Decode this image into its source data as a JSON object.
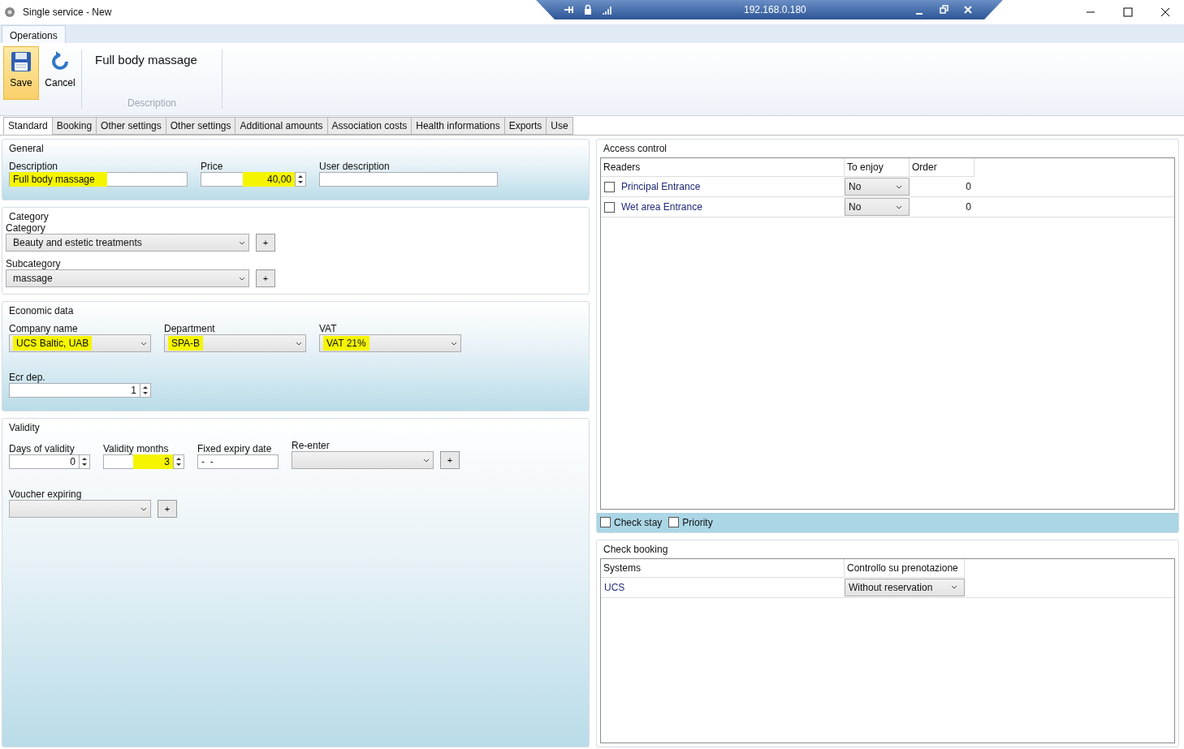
{
  "window": {
    "title": "Single service - New"
  },
  "remote_bar": {
    "address": "192.168.0.180"
  },
  "ribbon": {
    "tabs": [
      {
        "label": "Operations",
        "selected": true
      }
    ],
    "buttons": [
      {
        "label": "Save",
        "kind": "save",
        "selected": true
      },
      {
        "label": "Cancel",
        "kind": "cancel",
        "selected": false
      }
    ],
    "description": "Full body massage",
    "group_label": "Description"
  },
  "tabs": [
    {
      "label": "Standard",
      "selected": true
    },
    {
      "label": "Booking",
      "selected": false
    },
    {
      "label": "Other settings",
      "selected": false
    },
    {
      "label": "Other settings",
      "selected": false
    },
    {
      "label": "Additional amounts",
      "selected": false
    },
    {
      "label": "Association costs",
      "selected": false
    },
    {
      "label": "Health informations",
      "selected": false
    },
    {
      "label": "Exports",
      "selected": false
    },
    {
      "label": "Use",
      "selected": false
    }
  ],
  "sections": [
    {
      "title": "General",
      "kind": "shaded",
      "rows": [
        [
          {
            "label": "Description",
            "kind": "text",
            "value": "Full body massage",
            "highlighted": true
          },
          {
            "label": "Price",
            "kind": "spin",
            "value": "40,00",
            "highlighted": true
          },
          {
            "label": "User description",
            "kind": "text"
          }
        ]
      ]
    },
    {
      "title": "Category",
      "kind": "plain",
      "rows": [
        [
          {
            "label": "Category",
            "kind": "combo",
            "value": "Beauty and estetic treatments",
            "add": "+"
          }
        ],
        [
          {
            "label": "Subcategory",
            "kind": "combo",
            "value": "massage",
            "add": "+"
          }
        ]
      ]
    },
    {
      "title": "Economic data",
      "kind": "shaded",
      "rows": [
        [
          {
            "label": "Company name",
            "kind": "combo",
            "value": "UCS Baltic, UAB",
            "highlighted": true
          },
          {
            "label": "Department",
            "kind": "combo",
            "value": "SPA-B",
            "highlighted": true
          },
          {
            "label": "VAT",
            "kind": "combo",
            "value": "VAT 21%",
            "highlighted": true
          }
        ],
        [
          {
            "label": "Ecr dep.",
            "kind": "spin",
            "value": "1"
          }
        ]
      ]
    },
    {
      "title": "Validity",
      "kind": "shaded",
      "rows": [
        [
          {
            "label": "Days of validity",
            "kind": "spin",
            "value": "0"
          },
          {
            "label": "Validity months",
            "kind": "spin",
            "value": "3",
            "highlighted": true
          },
          {
            "label": "Fixed expiry date",
            "kind": "text",
            "value": "-  -"
          },
          {
            "label": "Re-enter",
            "kind": "combo",
            "add": "+"
          }
        ],
        [
          {
            "label": "Voucher expiring",
            "kind": "combo",
            "add": "+"
          }
        ]
      ]
    }
  ],
  "access_control": {
    "title": "Access control",
    "columns": [
      "Readers",
      "To enjoy",
      "Order"
    ],
    "rows": [
      {
        "reader": "Principal Entrance",
        "checked": false,
        "to_enjoy": "No",
        "order": "0"
      },
      {
        "reader": "Wet area Entrance",
        "checked": false,
        "to_enjoy": "No",
        "order": "0"
      }
    ],
    "options": [
      {
        "label": "Check stay",
        "checked": false
      },
      {
        "label": "Priority",
        "checked": false
      }
    ]
  },
  "check_booking": {
    "title": "Check booking",
    "columns": [
      "Systems",
      "Controllo su prenotazione"
    ],
    "rows": [
      {
        "system": "UCS",
        "control": "Without reservation"
      }
    ]
  }
}
